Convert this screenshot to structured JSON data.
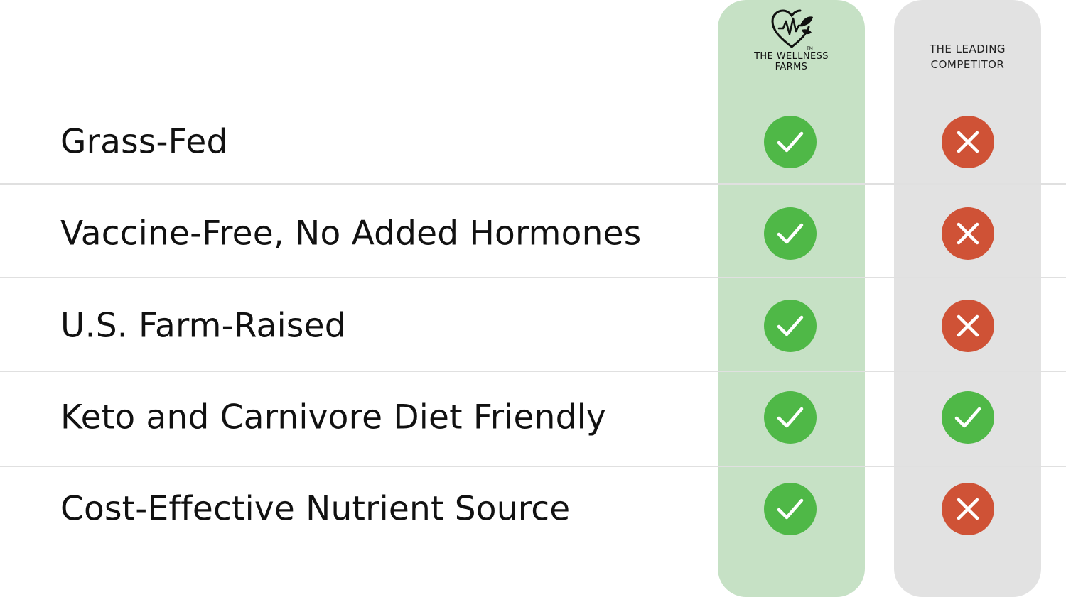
{
  "columns": {
    "brand": {
      "name_line1": "THE WELLNESS",
      "name_line2": "FARMS",
      "logo_icon": "heart-leaf-logo-icon",
      "background": "#c6e1c5"
    },
    "competitor": {
      "name_line1": "THE LEADING",
      "name_line2": "COMPETITOR",
      "background": "#e2e2e2"
    }
  },
  "colors": {
    "yes": "#4fb847",
    "no": "#cf5236"
  },
  "rows": [
    {
      "label": "Grass-Fed",
      "brand": "yes",
      "competitor": "no"
    },
    {
      "label": "Vaccine-Free, No Added Hormones",
      "brand": "yes",
      "competitor": "no"
    },
    {
      "label": "U.S. Farm-Raised",
      "brand": "yes",
      "competitor": "no"
    },
    {
      "label": "Keto and Carnivore Diet Friendly",
      "brand": "yes",
      "competitor": "yes"
    },
    {
      "label": "Cost-Effective Nutrient Source",
      "brand": "yes",
      "competitor": "no"
    }
  ]
}
